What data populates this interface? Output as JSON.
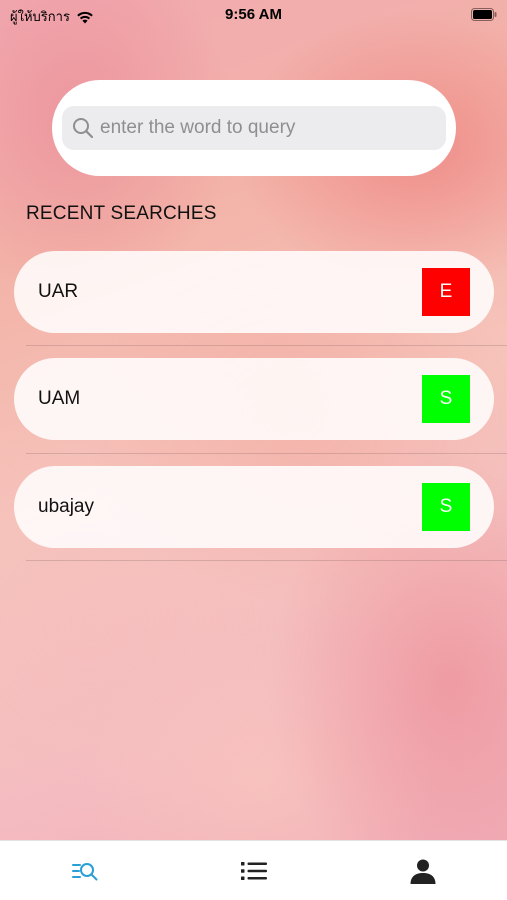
{
  "status_bar": {
    "carrier": "ผู้ให้บริการ",
    "time": "9:56 AM"
  },
  "search": {
    "placeholder": "enter the word to query",
    "value": "",
    "icon": "magnifier-icon"
  },
  "recent": {
    "title": "RECENT SEARCHES",
    "items": [
      {
        "word": "UAR",
        "badge": "E",
        "badge_color": "#ff0000"
      },
      {
        "word": "UAM",
        "badge": "S",
        "badge_color": "#00ff00"
      },
      {
        "word": "ubajay",
        "badge": "S",
        "badge_color": "#00ff00"
      }
    ]
  },
  "tab_bar": {
    "active_color": "#2a9fd6",
    "inactive_color": "#222222",
    "tabs": [
      {
        "icon": "search-list-icon",
        "active": true
      },
      {
        "icon": "list-icon",
        "active": false
      },
      {
        "icon": "person-icon",
        "active": false
      }
    ]
  }
}
